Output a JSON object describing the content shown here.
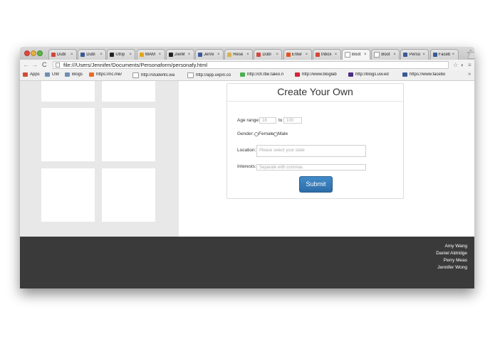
{
  "browser": {
    "tabs": [
      {
        "label": "Dubl",
        "icon": "gmail-icon",
        "color": "#d44638"
      },
      {
        "label": "Dubl",
        "icon": "tab-favicon-icon",
        "color": "#3b5998"
      },
      {
        "label": "Utrip",
        "icon": "utrip-icon",
        "color": "#222222"
      },
      {
        "label": "WAM",
        "icon": "wam-icon",
        "color": "#e6a519"
      },
      {
        "label": "JoeM",
        "icon": "github-icon",
        "color": "#222222"
      },
      {
        "label": "Jenni",
        "icon": "facebook-icon",
        "color": "#3b5998"
      },
      {
        "label": "Rese",
        "icon": "tab-favicon-icon",
        "color": "#d8b24a"
      },
      {
        "label": "Dubl",
        "icon": "gmail-icon",
        "color": "#d44638"
      },
      {
        "label": "Enter",
        "icon": "tab-favicon-icon",
        "color": "#e8501c"
      },
      {
        "label": "Inbox",
        "icon": "gmail-icon",
        "color": "#d44638"
      },
      {
        "label": "Boot",
        "icon": "page-icon",
        "color": "#ffffff"
      },
      {
        "label": "Boot",
        "icon": "page-icon",
        "color": "#ffffff"
      },
      {
        "label": "Perso",
        "icon": "facebook-icon",
        "color": "#3b5998"
      },
      {
        "label": "Faceb",
        "icon": "facebook-icon",
        "color": "#3b5998"
      }
    ],
    "tab_close": "×",
    "address": "file:///Users/Jennifer/Documents/Personaform/personafy.html",
    "bookmarks": [
      {
        "label": "Apps",
        "icon": "apps-grid-icon",
        "color": "#d04a3a"
      },
      {
        "label": "UW",
        "icon": "folder-icon",
        "color": "#6f8fb5"
      },
      {
        "label": "Blogs",
        "icon": "folder-icon",
        "color": "#6f8fb5"
      },
      {
        "label": "https://nc.me/",
        "icon": "nc-icon",
        "color": "#e96c2a"
      },
      {
        "label": "http://students.wa",
        "icon": "page-icon",
        "color": "#ffffff"
      },
      {
        "label": "http://app.uxpin.co",
        "icon": "page-icon",
        "color": "#ffffff"
      },
      {
        "label": "http://ch.tbe.taleo.n",
        "icon": "taleo-icon",
        "color": "#4caf50"
      },
      {
        "label": "http://www.bloglab",
        "icon": "bloglab-icon",
        "color": "#d0263a"
      },
      {
        "label": "http://blogs.uw.ed",
        "icon": "uw-icon",
        "color": "#4b2e83"
      },
      {
        "label": "https://www.facebo",
        "icon": "facebook-icon",
        "color": "#3b5998"
      }
    ],
    "bookmarks_overflow": "»"
  },
  "form": {
    "title": "Create Your Own",
    "age_label": "Age range:",
    "age_min_placeholder": "18",
    "age_to": "to",
    "age_max_placeholder": "100",
    "gender_label": "Gender:",
    "gender_female": "Female",
    "gender_male": "Male",
    "location_label": "Location:",
    "location_placeholder": "Please select your state",
    "interests_label": "Interests:",
    "interests_placeholder": "Separate with commas",
    "submit_label": "Submit",
    "accent_color": "#337ab7"
  },
  "footer": {
    "authors": [
      "Amy Wang",
      "Daniel Aldridge",
      "Perry Meas",
      "Jennifer Wong"
    ],
    "background_color": "#3a3a3a"
  }
}
